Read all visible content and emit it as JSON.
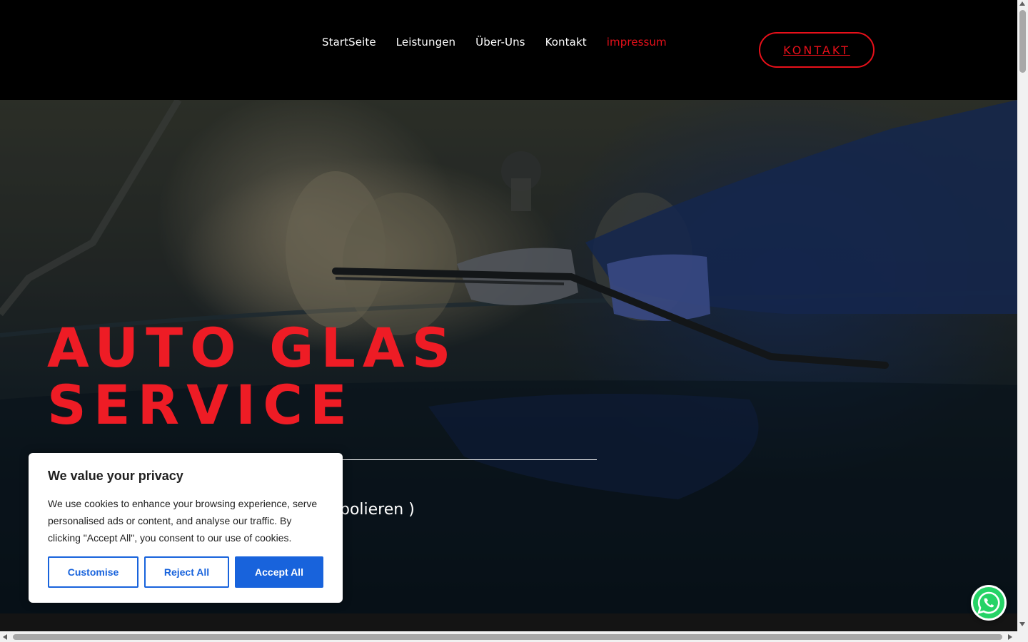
{
  "header": {
    "nav": [
      {
        "label": "StartSeite"
      },
      {
        "label": "Leistungen"
      },
      {
        "label": "Über-Uns"
      },
      {
        "label": "Kontakt"
      },
      {
        "label": "impressum",
        "active": true
      }
    ],
    "cta_label": "KONTAKT"
  },
  "hero": {
    "title_line1": "AUTO GLAS",
    "title_line2": "SERVICE",
    "subtitle_visible": "polieren )"
  },
  "cookie": {
    "title": "We value your privacy",
    "text": "We use cookies to enhance your browsing experience, serve personalised ads or content, and analyse our traffic. By clicking \"Accept All\", you consent to our use of cookies.",
    "customise_label": "Customise",
    "reject_label": "Reject All",
    "accept_label": "Accept All"
  },
  "colors": {
    "accent_red": "#e8101a",
    "cookie_blue": "#1863dc",
    "whatsapp_green": "#25d366"
  },
  "icons": {
    "floating": "whatsapp-icon"
  }
}
